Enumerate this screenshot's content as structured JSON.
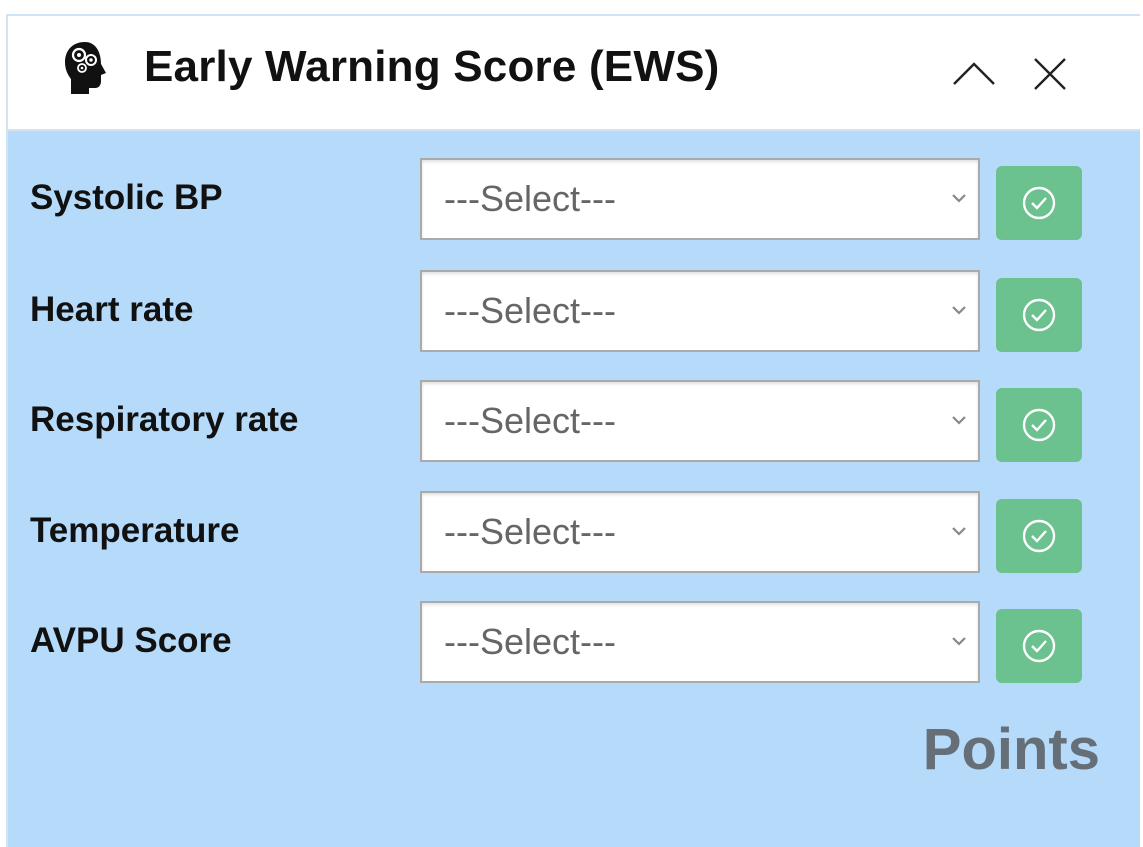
{
  "header": {
    "title": "Early Warning Score (EWS)",
    "icon": "brain-gears-icon",
    "collapse_icon": "chevron-up-icon",
    "close_icon": "close-icon"
  },
  "rows": [
    {
      "label": "Systolic BP",
      "value": "---Select---"
    },
    {
      "label": "Heart rate",
      "value": "---Select---"
    },
    {
      "label": "Respiratory rate",
      "value": "---Select---"
    },
    {
      "label": "Temperature",
      "value": "---Select---"
    },
    {
      "label": "AVPU Score",
      "value": "---Select---"
    }
  ],
  "confirm_icon": "check-circle-icon",
  "points_label": "Points",
  "colors": {
    "panel_background": "#b6dbfa",
    "confirm_button": "#6cc28e",
    "points_text": "#666f78"
  }
}
